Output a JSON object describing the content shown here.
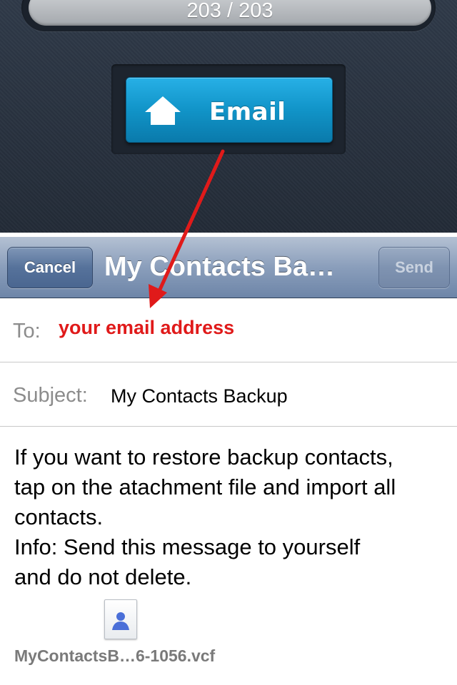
{
  "counter": {
    "text": "203 / 203"
  },
  "email_button": {
    "label": "Email",
    "icon": "home-icon"
  },
  "navbar": {
    "cancel_label": "Cancel",
    "title": "My Contacts Ba…",
    "send_label": "Send"
  },
  "to_field": {
    "label": "To:",
    "value": "your email address"
  },
  "subject_field": {
    "label": "Subject:",
    "value": "My Contacts Backup"
  },
  "body": {
    "lines": [
      "If you want to restore backup contacts,",
      "tap on the atachment file and import all",
      "contacts.",
      "Info: Send this message to yourself",
      "and do not delete."
    ]
  },
  "attachment": {
    "icon": "contact-card-icon",
    "filename": "MyContactsB…6-1056.vcf"
  },
  "colors": {
    "accent_blue": "#1194c8",
    "annotation_red": "#e01a1a",
    "navbar_blue": "#8a9ebb"
  }
}
